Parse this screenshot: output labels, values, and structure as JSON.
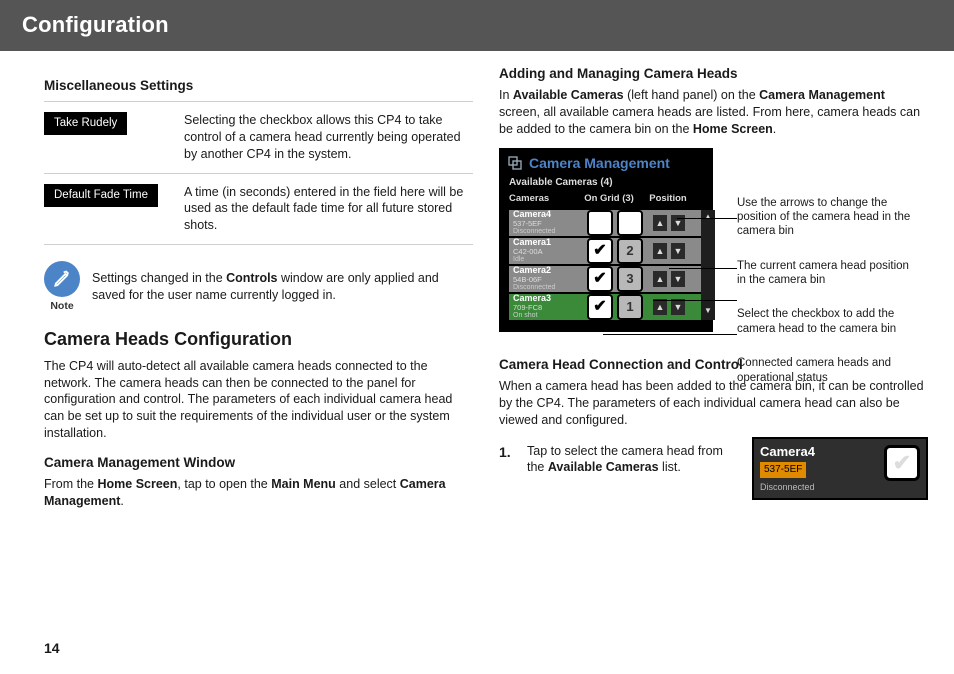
{
  "header": {
    "title": "Configuration"
  },
  "page_number": "14",
  "left": {
    "misc_heading": "Miscellaneous Settings",
    "rows": [
      {
        "label": "Take Rudely",
        "desc": "Selecting the checkbox allows this CP4 to take control of a camera head currently being operated by another CP4 in the system."
      },
      {
        "label": "Default Fade Time",
        "desc": "A time (in seconds) entered in the field here will be used as the default fade time for all future stored shots."
      }
    ],
    "note_label": "Note",
    "note_pre": "Settings changed in the ",
    "note_bold": "Controls",
    "note_post": " window are only applied and saved for the user name currently logged in.",
    "chc_heading": "Camera Heads Configuration",
    "chc_body": "The CP4 will auto-detect all available camera heads connected to the network. The camera heads can then be connected to the panel for configuration and control. The parameters of each individual camera head can be set up to suit the requirements of the individual user or the system installation.",
    "cmw_heading": "Camera Management Window",
    "cmw_pre": "From the ",
    "cmw_b1": "Home Screen",
    "cmw_mid": ", tap to open the ",
    "cmw_b2": "Main Menu",
    "cmw_mid2": " and select ",
    "cmw_b3": "Camera Management",
    "cmw_end": "."
  },
  "right": {
    "amch_heading": "Adding and Managing Camera Heads",
    "amch_pre": "In ",
    "amch_b1": "Available Cameras",
    "amch_mid1": " (left hand panel) on the ",
    "amch_b2": "Camera Management",
    "amch_mid2": " screen, all available camera heads are listed. From here, camera heads can be added to the camera bin on the ",
    "amch_b3": "Home Screen",
    "amch_end": ".",
    "panel": {
      "title": "Camera Management",
      "subtitle": "Available Cameras (4)",
      "cols": {
        "c1": "Cameras",
        "c2": "On Grid (3)",
        "c3": "Position"
      },
      "rows": [
        {
          "name": "Camera4",
          "id": "537-5EF",
          "status": "Disconnected",
          "checked": false,
          "pos": "",
          "on": false
        },
        {
          "name": "Camera1",
          "id": "C42-00A",
          "status": "Idle",
          "checked": true,
          "pos": "2",
          "on": false
        },
        {
          "name": "Camera2",
          "id": "54B-06F",
          "status": "Disconnected",
          "checked": true,
          "pos": "3",
          "on": false
        },
        {
          "name": "Camera3",
          "id": "709-FC8",
          "status": "On shot",
          "checked": true,
          "pos": "1",
          "on": true
        }
      ]
    },
    "callouts": [
      "Use the arrows to change the position of the camera head in the camera bin",
      "The current camera head position in the camera bin",
      "Select the checkbox to add the camera head to the camera bin",
      "Connected camera heads and operational status"
    ],
    "chcc_heading": "Camera Head Connection and Control",
    "chcc_body": "When a camera head has been added to the camera bin, it can be controlled by the CP4. The parameters of each individual camera head can also be viewed and configured.",
    "step1_num": "1.",
    "step1_pre": "Tap to select the camera head from the ",
    "step1_b": "Available Cameras",
    "step1_post": " list.",
    "chip": {
      "name": "Camera4",
      "id": "537-5EF",
      "status": "Disconnected"
    }
  }
}
